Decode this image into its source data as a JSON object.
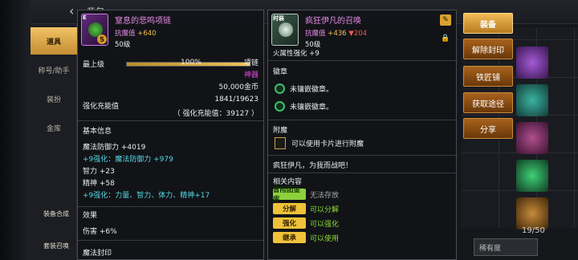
{
  "colors": {
    "accent": "#f2c255",
    "epic": "#e58ae6",
    "cyan": "#57d8e6",
    "green": "#8fdc37",
    "red": "#f05a4a"
  },
  "background": {
    "title_partial": "背包",
    "tabs": [
      "道具",
      "称号/助手",
      "装扮",
      "金库"
    ],
    "bottom_buttons": [
      "装备合成",
      "套装召唤"
    ],
    "slot_count": "19/50",
    "sort_label": "稀有度"
  },
  "left_panel": {
    "icon_corner": "E",
    "icon_badge": "5",
    "name": "窒息的悲鸣项链",
    "resist_label": "抗魔值",
    "resist_value": "+640",
    "level_req": "50级",
    "max_level_label": "最上级",
    "max_level_percent": "100%",
    "max_level_fill": 1.0,
    "item_type": "项链",
    "rarity": "神器",
    "price": "50,000金币",
    "reinforce_label": "强化充能值",
    "reinforce_value": "1841/19623",
    "reinforce_sub": "（ 强化充能值：39127 ）",
    "basic_info_title": "基本信息",
    "stats": [
      {
        "text": "魔法防御力 +4019",
        "color": "white"
      },
      {
        "text": "+9强化：魔法防御力 +979",
        "color": "cyan"
      },
      {
        "text": "智力 +23",
        "color": "white"
      },
      {
        "text": "精神 +58",
        "color": "white"
      },
      {
        "text": "+9强化：力量、智力、体力、精神+17",
        "color": "cyan"
      }
    ],
    "effect_title": "效果",
    "effect_line": "伤害 +6%",
    "cut_text": "魔法封印"
  },
  "right_panel": {
    "icon_corner": "时装",
    "name": "疯狂伊凡的召唤",
    "resist_label": "抗魔值",
    "resist_value": "+436",
    "resist_down": "▼204",
    "level_req": "50级",
    "cut_text": "火属性强化 +9",
    "emblem_title": "徽章",
    "emblems": [
      "未镶嵌徽章。",
      "未镶嵌徽章。"
    ],
    "enchant_title": "附魔",
    "enchant_text": "可以使用卡片进行附魔",
    "flavor_text": "疯狂伊凡，为我而战吧！",
    "related_title": "相关内容",
    "related": [
      {
        "tag": "冒险团金库",
        "text": "无法存放",
        "tag_style": "green",
        "text_color": "grey"
      },
      {
        "tag": "分解",
        "text": "可以分解",
        "tag_style": "yellow",
        "text_color": "green"
      },
      {
        "tag": "强化",
        "text": "可以强化",
        "tag_style": "yellow",
        "text_color": "green"
      },
      {
        "tag": "继承",
        "text": "可以使用",
        "tag_style": "yellow",
        "text_color": "green"
      }
    ]
  },
  "actions": {
    "equip": "装备",
    "unseal": "解除封印",
    "smith": "铁匠铺",
    "obtain": "获取途径",
    "share": "分享"
  }
}
